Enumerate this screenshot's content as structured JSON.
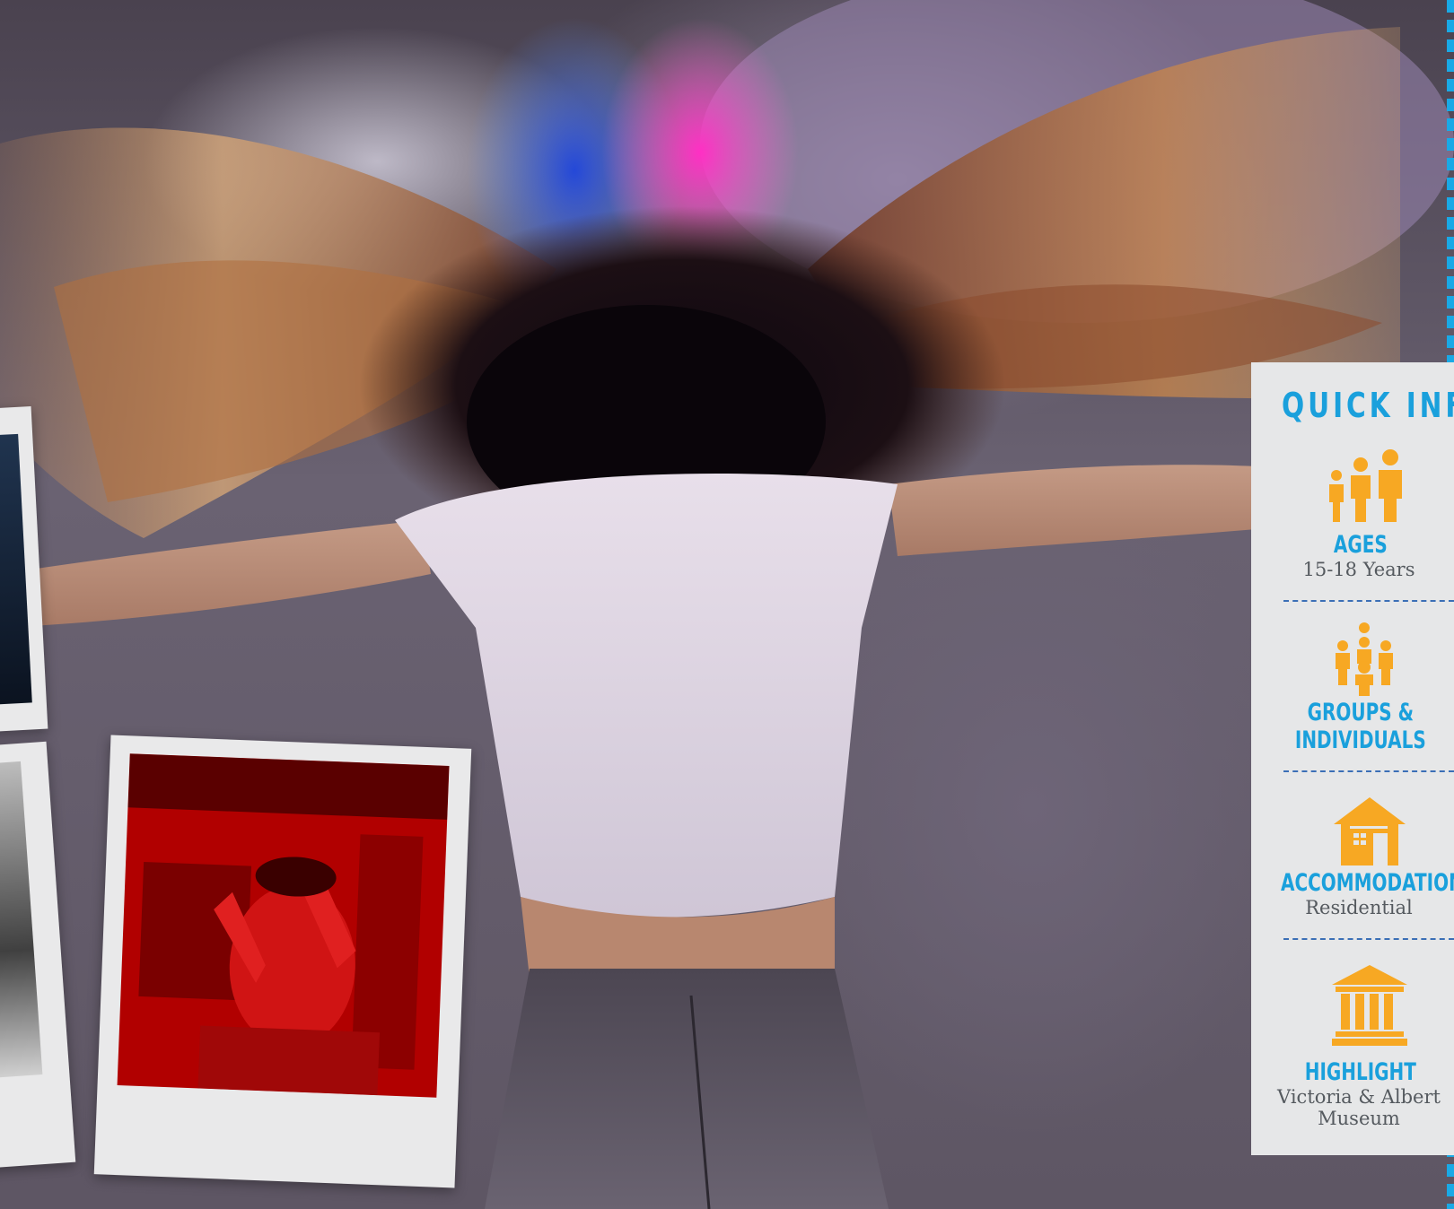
{
  "quick_info": {
    "title": "QUICK INFO",
    "items": [
      {
        "icon": "family-icon",
        "label": "AGES",
        "value": "15-18 Years"
      },
      {
        "icon": "group-icon",
        "label": "GROUPS &",
        "label2": "INDIVIDUALS",
        "value": ""
      },
      {
        "icon": "house-icon",
        "label": "ACCOMMODATION",
        "value": "Residential"
      },
      {
        "icon": "museum-icon",
        "label": "HIGHLIGHT",
        "value": "Victoria & Albert",
        "value2": "Museum"
      }
    ]
  },
  "colors": {
    "accent_blue": "#1aa0dc",
    "icon_orange": "#f7a823",
    "panel_bg": "#e6e7e8"
  }
}
